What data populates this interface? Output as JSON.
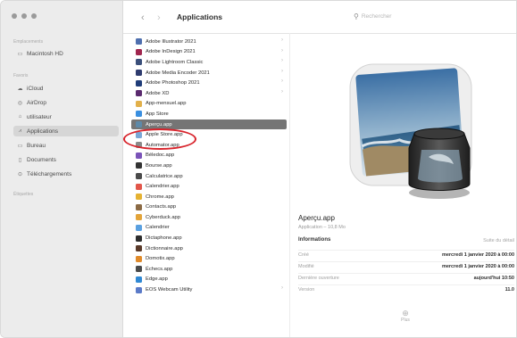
{
  "window": {
    "title": "Applications"
  },
  "toolbar": {
    "back": "‹",
    "forward": "›",
    "search_placeholder": "Rechercher",
    "search_icon": "search-icon"
  },
  "sidebar": {
    "section_locations": "Emplacements",
    "locations": [
      {
        "label": "Macintosh HD",
        "icon": "disk-icon"
      }
    ],
    "section_favorites": "Favoris",
    "favorites": [
      {
        "label": "iCloud",
        "icon": "cloud-icon"
      },
      {
        "label": "AirDrop",
        "icon": "airdrop-icon"
      },
      {
        "label": "utilisateur",
        "icon": "home-icon"
      },
      {
        "label": "Applications",
        "icon": "applications-icon",
        "selected": true
      },
      {
        "label": "Bureau",
        "icon": "desktop-icon"
      },
      {
        "label": "Documents",
        "icon": "document-icon"
      },
      {
        "label": "Téléchargements",
        "icon": "download-icon"
      }
    ],
    "section_tags": "Étiquettes"
  },
  "files": [
    {
      "name": "Adobe Illustrator 2021",
      "color": "#4e6fae",
      "folder": true
    },
    {
      "name": "Adobe InDesign 2021",
      "color": "#a0264e",
      "folder": true
    },
    {
      "name": "Adobe Lightroom Classic",
      "color": "#3a4f7a",
      "folder": true
    },
    {
      "name": "Adobe Media Encoder 2021",
      "color": "#2e3b6e",
      "folder": true
    },
    {
      "name": "Adobe Photoshop 2021",
      "color": "#1f3c78",
      "folder": true
    },
    {
      "name": "Adobe XD",
      "color": "#5a2a6e",
      "folder": true
    },
    {
      "name": "App-mensuel.app",
      "color": "#e2b04a",
      "folder": false
    },
    {
      "name": "App Store",
      "color": "#3a8fe0",
      "folder": false
    },
    {
      "name": "Aperçu.app",
      "color": "#5d89a8",
      "folder": false,
      "selected": true
    },
    {
      "name": "Apple Store.app",
      "color": "#7aa7d6",
      "folder": false
    },
    {
      "name": "Automator.app",
      "color": "#8a8a8a",
      "folder": false
    },
    {
      "name": "Béledoc.app",
      "color": "#7a53b8",
      "folder": false
    },
    {
      "name": "Bourse.app",
      "color": "#333333",
      "folder": false
    },
    {
      "name": "Calculatrice.app",
      "color": "#4a4a4a",
      "folder": false
    },
    {
      "name": "Calendrier.app",
      "color": "#e2564a",
      "folder": false
    },
    {
      "name": "Chrome.app",
      "color": "#e5b232",
      "folder": false
    },
    {
      "name": "Contacts.app",
      "color": "#8b6a44",
      "folder": false
    },
    {
      "name": "Cyberduck.app",
      "color": "#e3a43a",
      "folder": false
    },
    {
      "name": "Calendrier",
      "color": "#5aa0e0",
      "folder": false
    },
    {
      "name": "Dictaphone.app",
      "color": "#2d2d2d",
      "folder": false
    },
    {
      "name": "Dictionnaire.app",
      "color": "#5a3a2a",
      "folder": false
    },
    {
      "name": "Domotix.app",
      "color": "#e08a2a",
      "folder": false
    },
    {
      "name": "Échecs.app",
      "color": "#4a4a4a",
      "folder": false
    },
    {
      "name": "Edge.app",
      "color": "#2f88d4",
      "folder": false
    },
    {
      "name": "EOS Webcam Utility",
      "color": "#5a7ac8",
      "folder": true
    }
  ],
  "preview": {
    "icon": "preview-app-icon",
    "name": "Aperçu.app",
    "subtitle": "Application – 10,8 Mo",
    "info_title": "Informations",
    "info_more": "Suite du détail",
    "rows": [
      {
        "key": "Créé",
        "value": "mercredi 1 janvier 2020 à 00:00"
      },
      {
        "key": "Modifié",
        "value": "mercredi 1 janvier 2020 à 00:00"
      },
      {
        "key": "Dernière ouverture",
        "value": "aujourd'hui 10:50"
      },
      {
        "key": "Version",
        "value": "11.0"
      }
    ],
    "more_button": "Plus",
    "more_icon": "plus-icon"
  }
}
